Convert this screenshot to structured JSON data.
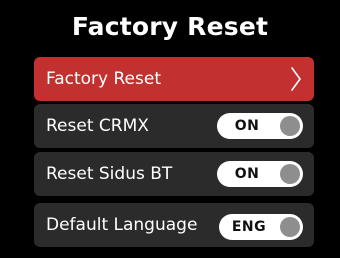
{
  "page": {
    "title": "Factory Reset"
  },
  "menu": {
    "items": [
      {
        "label": "Factory Reset",
        "selected": true,
        "control": "chevron"
      },
      {
        "label": "Reset CRMX",
        "control": "toggle",
        "value": "ON"
      },
      {
        "label": "Reset Sidus BT",
        "control": "toggle",
        "value": "ON"
      },
      {
        "label": "Default Language",
        "control": "toggle",
        "value": "ENG"
      }
    ]
  },
  "colors": {
    "background": "#000000",
    "row": "#2b2b2b",
    "selected_row": "#c2312f",
    "toggle": "#ffffff",
    "knob": "#8e8e8e"
  },
  "icons": {
    "chevron": "chevron-right-icon"
  }
}
